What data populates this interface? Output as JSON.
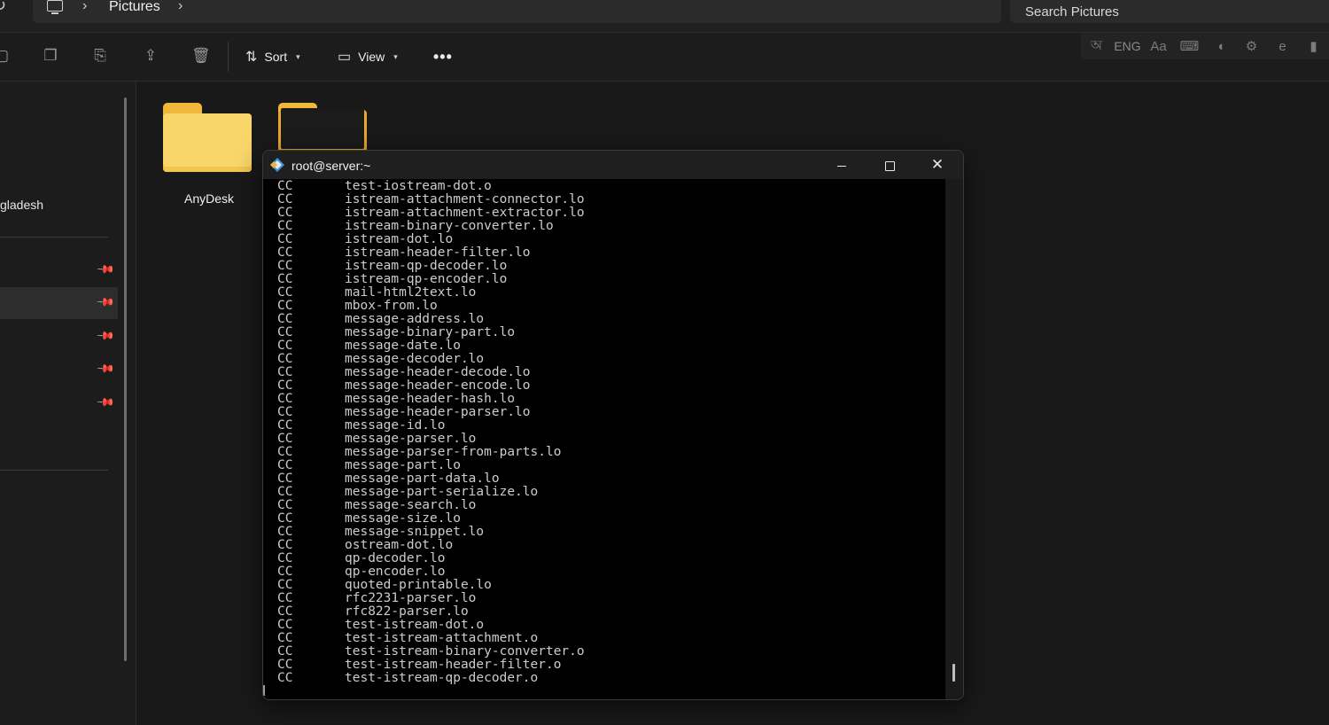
{
  "explorer": {
    "breadcrumb": {
      "current": "Pictures"
    },
    "search_placeholder": "Search Pictures",
    "toolbar": {
      "sort_label": "Sort",
      "view_label": "View",
      "more_label": "•••"
    },
    "tray": {
      "language": "ENG"
    },
    "nav": {
      "partial_item": "gladesh"
    },
    "folders": [
      {
        "name": "AnyDesk"
      }
    ]
  },
  "terminal": {
    "title": "root@server:~",
    "lines": [
      {
        "tag": "CC",
        "file": "test-iostream-dot.o"
      },
      {
        "tag": "CC",
        "file": "istream-attachment-connector.lo"
      },
      {
        "tag": "CC",
        "file": "istream-attachment-extractor.lo"
      },
      {
        "tag": "CC",
        "file": "istream-binary-converter.lo"
      },
      {
        "tag": "CC",
        "file": "istream-dot.lo"
      },
      {
        "tag": "CC",
        "file": "istream-header-filter.lo"
      },
      {
        "tag": "CC",
        "file": "istream-qp-decoder.lo"
      },
      {
        "tag": "CC",
        "file": "istream-qp-encoder.lo"
      },
      {
        "tag": "CC",
        "file": "mail-html2text.lo"
      },
      {
        "tag": "CC",
        "file": "mbox-from.lo"
      },
      {
        "tag": "CC",
        "file": "message-address.lo"
      },
      {
        "tag": "CC",
        "file": "message-binary-part.lo"
      },
      {
        "tag": "CC",
        "file": "message-date.lo"
      },
      {
        "tag": "CC",
        "file": "message-decoder.lo"
      },
      {
        "tag": "CC",
        "file": "message-header-decode.lo"
      },
      {
        "tag": "CC",
        "file": "message-header-encode.lo"
      },
      {
        "tag": "CC",
        "file": "message-header-hash.lo"
      },
      {
        "tag": "CC",
        "file": "message-header-parser.lo"
      },
      {
        "tag": "CC",
        "file": "message-id.lo"
      },
      {
        "tag": "CC",
        "file": "message-parser.lo"
      },
      {
        "tag": "CC",
        "file": "message-parser-from-parts.lo"
      },
      {
        "tag": "CC",
        "file": "message-part.lo"
      },
      {
        "tag": "CC",
        "file": "message-part-data.lo"
      },
      {
        "tag": "CC",
        "file": "message-part-serialize.lo"
      },
      {
        "tag": "CC",
        "file": "message-search.lo"
      },
      {
        "tag": "CC",
        "file": "message-size.lo"
      },
      {
        "tag": "CC",
        "file": "message-snippet.lo"
      },
      {
        "tag": "CC",
        "file": "ostream-dot.lo"
      },
      {
        "tag": "CC",
        "file": "qp-decoder.lo"
      },
      {
        "tag": "CC",
        "file": "qp-encoder.lo"
      },
      {
        "tag": "CC",
        "file": "quoted-printable.lo"
      },
      {
        "tag": "CC",
        "file": "rfc2231-parser.lo"
      },
      {
        "tag": "CC",
        "file": "rfc822-parser.lo"
      },
      {
        "tag": "CC",
        "file": "test-istream-dot.o"
      },
      {
        "tag": "CC",
        "file": "test-istream-attachment.o"
      },
      {
        "tag": "CC",
        "file": "test-istream-binary-converter.o"
      },
      {
        "tag": "CC",
        "file": "test-istream-header-filter.o"
      },
      {
        "tag": "CC",
        "file": "test-istream-qp-decoder.o"
      }
    ]
  },
  "colors": {
    "folder_yellow": "#f9d66a",
    "terminal_bg": "#000000",
    "terminal_text": "#cccccc"
  }
}
